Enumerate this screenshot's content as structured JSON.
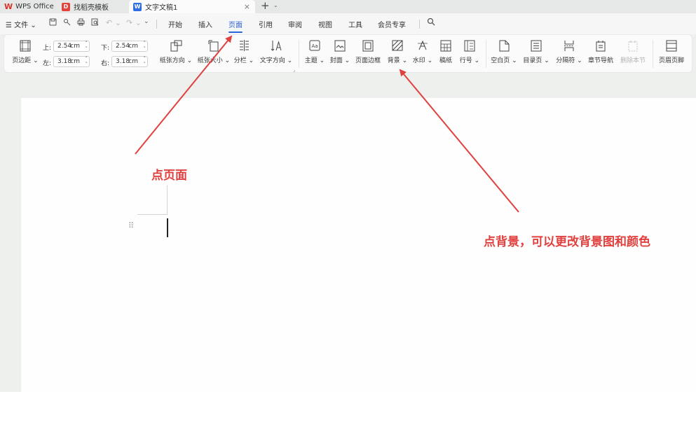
{
  "tabbar": {
    "app_name": "WPS Office",
    "tabs": [
      {
        "label": "找稻壳模板",
        "icon": "docer-icon"
      },
      {
        "label": "文字文稿1",
        "icon": "word-doc-icon",
        "close": "×"
      }
    ],
    "add_tab": "+",
    "more": "⌄"
  },
  "menubar": {
    "file_label": "☰ 文件 ⌄",
    "tabs": [
      "开始",
      "插入",
      "页面",
      "引用",
      "审阅",
      "视图",
      "工具",
      "会员专享"
    ],
    "active_tab": "页面"
  },
  "ribbon": {
    "margins_label": "页边距",
    "top_label": "上:",
    "top_value": "2.54",
    "bottom_label": "下:",
    "bottom_value": "2.54",
    "left_label": "左:",
    "left_value": "3.18",
    "right_label": "右:",
    "right_value": "3.18",
    "unit": "cm",
    "orientation_label": "纸张方向",
    "size_label": "纸张大小",
    "columns_label": "分栏",
    "text_direction_label": "文字方向",
    "theme_label": "主题",
    "cover_label": "封面",
    "page_border_label": "页面边框",
    "background_label": "背景",
    "watermark_label": "水印",
    "manuscript_label": "稿纸",
    "line_number_label": "行号",
    "blank_page_label": "空白页",
    "toc_page_label": "目录页",
    "break_label": "分隔符",
    "section_nav_label": "章节导航",
    "delete_section_label": "删除本节",
    "header_footer_label": "页眉页脚"
  },
  "annotations": {
    "page_hint": "点页面",
    "background_hint": "点背景，可以更改背景图和颜色",
    "color": "#e0403e"
  }
}
